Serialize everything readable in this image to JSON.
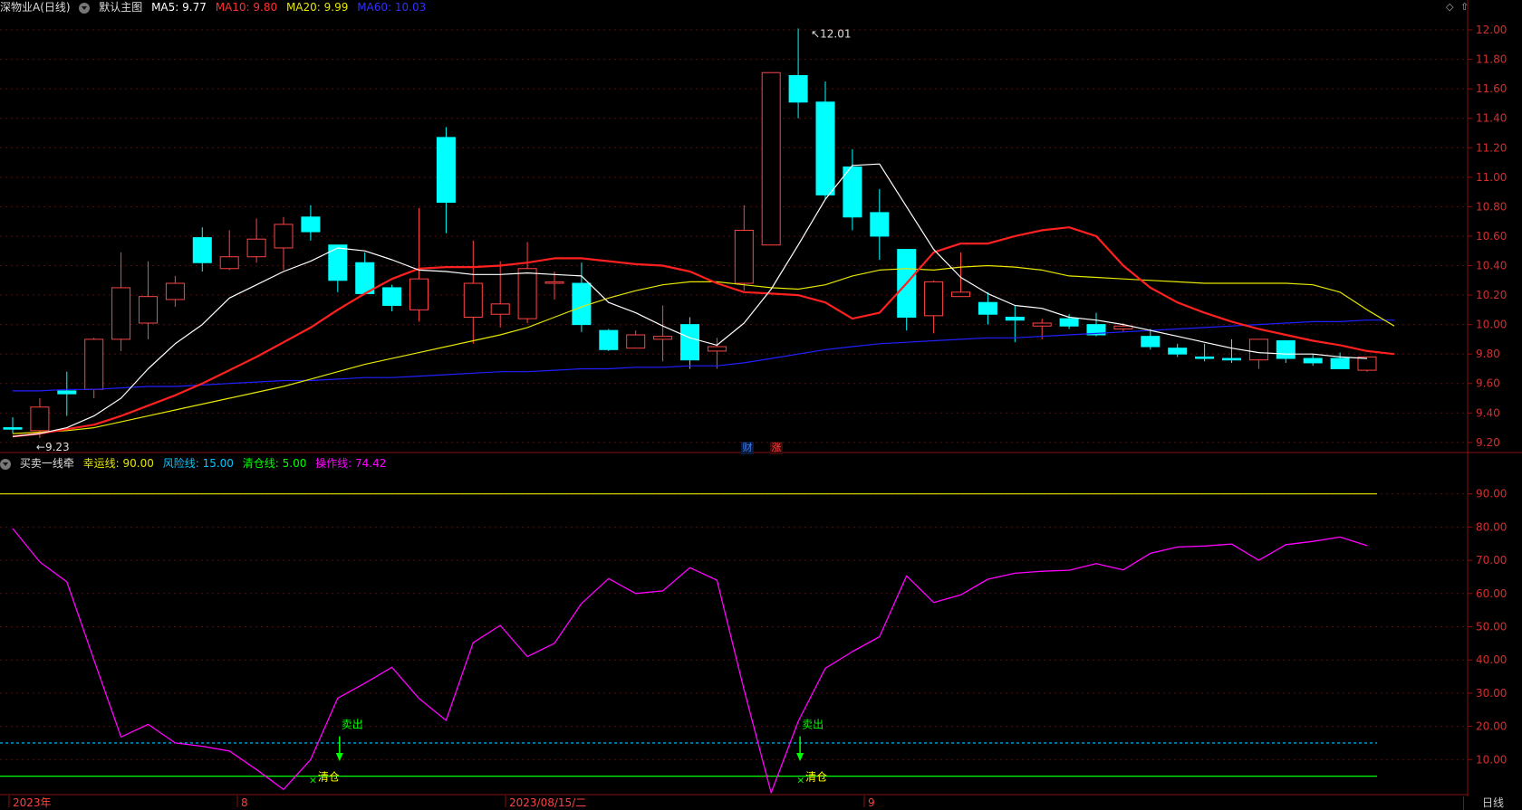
{
  "header": {
    "stock_name": "深物业A(日线)",
    "main_chart_label": "默认主图",
    "ma5_label": "MA5: 9.77",
    "ma10_label": "MA10: 9.80",
    "ma20_label": "MA20: 9.99",
    "ma60_label": "MA60: 10.03",
    "corner_icon_1": "◇",
    "corner_icon_2": "⇧"
  },
  "indicator_header": {
    "name": "买卖一线牵",
    "luck_label": "幸运线: 90.00",
    "risk_label": "风险线: 15.00",
    "clear_label": "清仓线: 5.00",
    "op_label": "操作线: 74.42"
  },
  "badges": {
    "cai": "财",
    "zhang": "涨"
  },
  "signals": {
    "sell": "卖出",
    "clear": "清仓"
  },
  "annotations": {
    "high": "12.01",
    "low": "9.23"
  },
  "time_axis": [
    "2023年",
    "8",
    "2023/08/15/二",
    "9"
  ],
  "period_button": "日线",
  "colors": {
    "up": "#ff4444",
    "down": "#00ffff",
    "ma5": "#ffffff",
    "ma10": "#ff2020",
    "ma20": "#e6e600",
    "ma60": "#2020ff",
    "luck": "#e6e600",
    "risk": "#00c8ff",
    "clear": "#00ff00",
    "op": "#ff00ff"
  },
  "chart_data": [
    {
      "type": "candlestick",
      "y_ticks": [
        "12.00",
        "11.80",
        "11.60",
        "11.40",
        "11.20",
        "11.00",
        "10.80",
        "10.60",
        "10.40",
        "10.20",
        "10.00",
        "9.80",
        "9.60",
        "9.40",
        "9.20"
      ],
      "ylim": [
        9.15,
        12.08
      ],
      "candles": [
        {
          "o": 9.3,
          "h": 9.37,
          "l": 9.26,
          "c": 9.29
        },
        {
          "o": 9.28,
          "h": 9.5,
          "l": 9.23,
          "c": 9.44
        },
        {
          "o": 9.55,
          "h": 9.68,
          "l": 9.38,
          "c": 9.53
        },
        {
          "o": 9.56,
          "h": 9.91,
          "l": 9.5,
          "c": 9.9
        },
        {
          "o": 9.9,
          "h": 10.49,
          "l": 9.82,
          "c": 10.25
        },
        {
          "o": 10.01,
          "h": 10.43,
          "l": 9.9,
          "c": 10.19
        },
        {
          "o": 10.17,
          "h": 10.33,
          "l": 10.12,
          "c": 10.28
        },
        {
          "o": 10.59,
          "h": 10.66,
          "l": 10.36,
          "c": 10.42
        },
        {
          "o": 10.38,
          "h": 10.64,
          "l": 10.37,
          "c": 10.46
        },
        {
          "o": 10.46,
          "h": 10.72,
          "l": 10.42,
          "c": 10.58
        },
        {
          "o": 10.52,
          "h": 10.73,
          "l": 10.37,
          "c": 10.68
        },
        {
          "o": 10.73,
          "h": 10.81,
          "l": 10.57,
          "c": 10.63
        },
        {
          "o": 10.54,
          "h": 10.54,
          "l": 10.22,
          "c": 10.3
        },
        {
          "o": 10.42,
          "h": 10.49,
          "l": 10.21,
          "c": 10.21
        },
        {
          "o": 10.25,
          "h": 10.27,
          "l": 10.09,
          "c": 10.13
        },
        {
          "o": 10.1,
          "h": 10.79,
          "l": 10.02,
          "c": 10.31
        },
        {
          "o": 11.27,
          "h": 11.34,
          "l": 10.62,
          "c": 10.83
        },
        {
          "o": 10.05,
          "h": 10.57,
          "l": 9.87,
          "c": 10.28
        },
        {
          "o": 10.07,
          "h": 10.43,
          "l": 9.98,
          "c": 10.14
        },
        {
          "o": 10.04,
          "h": 10.56,
          "l": 10.01,
          "c": 10.38
        },
        {
          "o": 10.28,
          "h": 10.36,
          "l": 10.17,
          "c": 10.29
        },
        {
          "o": 10.28,
          "h": 10.42,
          "l": 9.95,
          "c": 10.0
        },
        {
          "o": 9.96,
          "h": 9.97,
          "l": 9.82,
          "c": 9.83
        },
        {
          "o": 9.84,
          "h": 9.96,
          "l": 9.84,
          "c": 9.93
        },
        {
          "o": 9.9,
          "h": 10.13,
          "l": 9.75,
          "c": 9.92
        },
        {
          "o": 10.0,
          "h": 10.05,
          "l": 9.7,
          "c": 9.76
        },
        {
          "o": 9.82,
          "h": 9.91,
          "l": 9.7,
          "c": 9.85
        },
        {
          "o": 10.28,
          "h": 10.81,
          "l": 10.23,
          "c": 10.64
        },
        {
          "o": 10.54,
          "h": 11.71,
          "l": 10.54,
          "c": 11.71
        },
        {
          "o": 11.69,
          "h": 12.01,
          "l": 11.4,
          "c": 11.51
        },
        {
          "o": 11.51,
          "h": 11.65,
          "l": 10.85,
          "c": 10.88
        },
        {
          "o": 11.07,
          "h": 11.19,
          "l": 10.64,
          "c": 10.73
        },
        {
          "o": 10.76,
          "h": 10.92,
          "l": 10.44,
          "c": 10.6
        },
        {
          "o": 10.51,
          "h": 10.51,
          "l": 9.96,
          "c": 10.05
        },
        {
          "o": 10.06,
          "h": 10.3,
          "l": 9.94,
          "c": 10.29
        },
        {
          "o": 10.19,
          "h": 10.49,
          "l": 10.19,
          "c": 10.22
        },
        {
          "o": 10.15,
          "h": 10.22,
          "l": 10.0,
          "c": 10.07
        },
        {
          "o": 10.05,
          "h": 10.13,
          "l": 9.88,
          "c": 10.03
        },
        {
          "o": 9.99,
          "h": 10.04,
          "l": 9.9,
          "c": 10.01
        },
        {
          "o": 10.04,
          "h": 10.07,
          "l": 9.97,
          "c": 9.99
        },
        {
          "o": 10.0,
          "h": 10.08,
          "l": 9.92,
          "c": 9.93
        },
        {
          "o": 9.97,
          "h": 10.01,
          "l": 9.95,
          "c": 9.99
        },
        {
          "o": 9.92,
          "h": 9.97,
          "l": 9.83,
          "c": 9.85
        },
        {
          "o": 9.84,
          "h": 9.87,
          "l": 9.78,
          "c": 9.8
        },
        {
          "o": 9.78,
          "h": 9.87,
          "l": 9.75,
          "c": 9.77
        },
        {
          "o": 9.77,
          "h": 9.9,
          "l": 9.74,
          "c": 9.76
        },
        {
          "o": 9.76,
          "h": 9.89,
          "l": 9.7,
          "c": 9.9
        },
        {
          "o": 9.89,
          "h": 9.89,
          "l": 9.74,
          "c": 9.77
        },
        {
          "o": 9.77,
          "h": 9.8,
          "l": 9.72,
          "c": 9.74
        },
        {
          "o": 9.77,
          "h": 9.81,
          "l": 9.7,
          "c": 9.7
        },
        {
          "o": 9.69,
          "h": 9.78,
          "l": 9.68,
          "c": 9.78
        }
      ],
      "ma5": [
        9.24,
        9.26,
        9.3,
        9.38,
        9.5,
        9.7,
        9.87,
        10.0,
        10.18,
        10.27,
        10.36,
        10.43,
        10.52,
        10.5,
        10.44,
        10.37,
        10.36,
        10.34,
        10.34,
        10.35,
        10.34,
        10.33,
        10.15,
        10.08,
        9.99,
        9.91,
        9.86,
        10.01,
        10.24,
        10.54,
        10.85,
        11.08,
        11.09,
        10.8,
        10.51,
        10.32,
        10.21,
        10.13,
        10.11,
        10.05,
        10.03,
        10.0,
        9.96,
        9.92,
        9.88,
        9.84,
        9.81,
        9.8,
        9.8,
        9.78,
        9.77
      ],
      "ma10": [
        9.24,
        9.26,
        9.29,
        9.32,
        9.38,
        9.45,
        9.52,
        9.6,
        9.69,
        9.78,
        9.88,
        9.98,
        10.1,
        10.21,
        10.31,
        10.38,
        10.39,
        10.39,
        10.4,
        10.42,
        10.45,
        10.45,
        10.43,
        10.41,
        10.4,
        10.36,
        10.28,
        10.22,
        10.21,
        10.2,
        10.15,
        10.04,
        10.08,
        10.28,
        10.49,
        10.55,
        10.55,
        10.6,
        10.64,
        10.66,
        10.6,
        10.4,
        10.25,
        10.15,
        10.08,
        10.02,
        9.97,
        9.93,
        9.89,
        9.86,
        9.82,
        9.8
      ],
      "ma20": [
        9.26,
        9.27,
        9.28,
        9.3,
        9.34,
        9.38,
        9.42,
        9.46,
        9.5,
        9.54,
        9.58,
        9.63,
        9.68,
        9.73,
        9.77,
        9.81,
        9.85,
        9.89,
        9.93,
        9.98,
        10.05,
        10.12,
        10.18,
        10.23,
        10.27,
        10.29,
        10.29,
        10.27,
        10.25,
        10.24,
        10.27,
        10.33,
        10.37,
        10.38,
        10.37,
        10.39,
        10.4,
        10.39,
        10.37,
        10.33,
        10.32,
        10.31,
        10.3,
        10.29,
        10.28,
        10.28,
        10.28,
        10.28,
        10.27,
        10.22,
        10.1,
        9.99
      ],
      "ma60": [
        9.55,
        9.55,
        9.56,
        9.56,
        9.57,
        9.58,
        9.58,
        9.59,
        9.6,
        9.61,
        9.62,
        9.62,
        9.63,
        9.64,
        9.64,
        9.65,
        9.66,
        9.67,
        9.68,
        9.68,
        9.69,
        9.7,
        9.7,
        9.71,
        9.71,
        9.72,
        9.72,
        9.74,
        9.77,
        9.8,
        9.83,
        9.85,
        9.87,
        9.88,
        9.89,
        9.9,
        9.91,
        9.91,
        9.92,
        9.93,
        9.94,
        9.95,
        9.96,
        9.97,
        9.98,
        9.99,
        10.0,
        10.01,
        10.02,
        10.02,
        10.03,
        10.03
      ]
    },
    {
      "type": "line",
      "y_ticks": [
        "90.00",
        "80.00",
        "70.00",
        "60.00",
        "50.00",
        "40.00",
        "30.00",
        "20.00",
        "10.00"
      ],
      "ylim": [
        0,
        97
      ],
      "luck_line": 90,
      "risk_line": 15,
      "clear_line": 5,
      "operation_line": [
        79.6,
        69.5,
        63.5,
        40.0,
        16.8,
        20.6,
        15.0,
        14.0,
        12.6,
        7.0,
        1.0,
        10.0,
        28.5,
        33.0,
        37.8,
        28.4,
        21.8,
        45.2,
        50.4,
        41.0,
        45.0,
        57.0,
        64.5,
        60.0,
        60.8,
        67.8,
        64.0,
        31.0,
        0.0,
        21.5,
        37.5,
        42.5,
        47.0,
        65.3,
        57.3,
        59.6,
        64.3,
        66.1,
        66.7,
        67.0,
        69.0,
        67.1,
        72.1,
        74.0,
        74.3,
        74.9,
        70.0,
        74.7,
        75.7,
        77.0,
        74.4
      ],
      "sell_signals": [
        12,
        29
      ],
      "clear_signals": [
        11,
        29
      ]
    }
  ]
}
